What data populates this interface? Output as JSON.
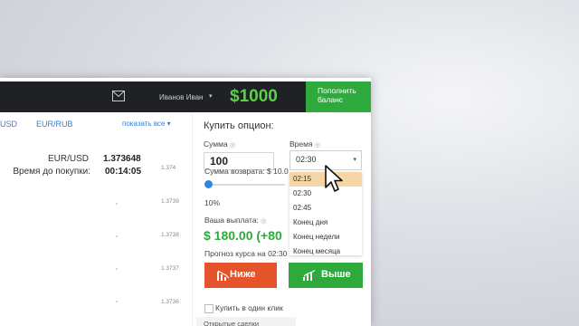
{
  "header": {
    "user_name": "Иванов Иван",
    "user_caret": "▾",
    "balance": "$1000",
    "topup_line1": "Пополнить",
    "topup_line2": "баланс",
    "icons": [
      "mail-icon"
    ]
  },
  "assets": {
    "tabs": [
      "USD",
      "EUR/RUB"
    ],
    "show_all": "показать все ▾",
    "pair_label": "EUR/USD",
    "pair_value": "1.373648",
    "time_label": "Время до покупки:",
    "time_value": "00:14:05",
    "scale": [
      "1.374",
      "1.3739",
      "1.3738",
      "1.3737",
      "1.3736"
    ]
  },
  "option": {
    "title": "Купить опцион:",
    "amount_label": "Сумма",
    "info_mark": "◎",
    "amount_value": "100",
    "time_label": "Время",
    "time_value": "02:30",
    "select_caret": "▾",
    "dropdown_items": [
      "02:15",
      "02:30",
      "02:45",
      "Конец дня",
      "Конец недели",
      "Конец месяца"
    ],
    "return_label": "Сумма возврата: $ 10.0",
    "return_percent": "10%",
    "return_fraction": 0.1,
    "payout_label": "Ваша выплата:",
    "payout_value": "$ 180.00 (+80",
    "forecast_label": "Прогноз курса на 02:30",
    "down_button": "Ниже",
    "up_button": "Выше",
    "one_click_label": "Купить в один клик",
    "open_trades": "Открытые сделки"
  },
  "colors": {
    "accent_green": "#2eaa3c",
    "balance_green": "#5ad04a",
    "down_red": "#e5532a",
    "link_blue": "#3a7fd0",
    "dropdown_highlight": "#f6d6a6"
  }
}
